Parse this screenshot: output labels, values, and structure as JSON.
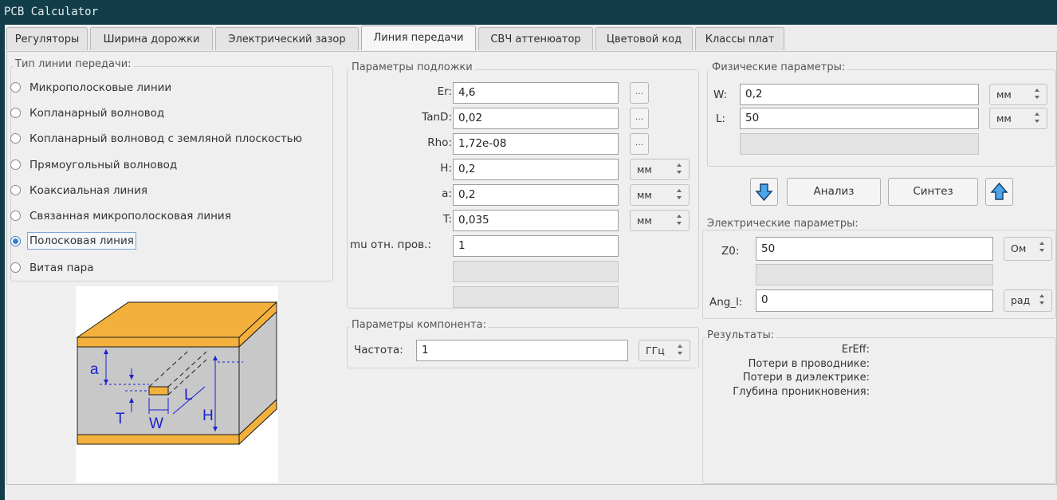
{
  "window": {
    "title": "PCB Calculator"
  },
  "tabs": [
    "Регуляторы",
    "Ширина дорожки",
    "Электрический зазор",
    "Линия передачи",
    "СВЧ аттенюатор",
    "Цветовой код",
    "Классы плат"
  ],
  "line_type": {
    "title": "Тип линии передачи:",
    "options": [
      {
        "label": "Микрополосковые линии",
        "selected": false
      },
      {
        "label": "Копланарный волновод",
        "selected": false
      },
      {
        "label": "Копланарный волновод с земляной плоскостью",
        "selected": false
      },
      {
        "label": "Прямоугольный волновод",
        "selected": false
      },
      {
        "label": "Коаксиальная линия",
        "selected": false
      },
      {
        "label": "Связанная микрополосковая линия",
        "selected": false
      },
      {
        "label": "Полосковая линия",
        "selected": true
      },
      {
        "label": "Витая пара",
        "selected": false
      }
    ]
  },
  "diagram": {
    "labels": {
      "a": "a",
      "T": "T",
      "W": "W",
      "L": "L",
      "H": "H"
    },
    "colors": {
      "copper": "#f4b03c",
      "dielectric": "#c8c8c8",
      "dim": "#1a22d0"
    }
  },
  "substrate": {
    "title": "Параметры подложки",
    "rows": [
      {
        "label": "Er:",
        "value": "4,6",
        "button": "..."
      },
      {
        "label": "TanD:",
        "value": "0,02",
        "button": "..."
      },
      {
        "label": "Rho:",
        "value": "1,72e-08",
        "button": "..."
      },
      {
        "label": "H:",
        "value": "0,2",
        "unit": "мм"
      },
      {
        "label": "a:",
        "value": "0,2",
        "unit": "мм"
      },
      {
        "label": "T:",
        "value": "0,035",
        "unit": "мм"
      },
      {
        "label": "mu отн. пров.:",
        "value": "1"
      }
    ]
  },
  "component": {
    "title": "Параметры компонента:",
    "label": "Частота:",
    "value": "1",
    "unit": "ГГц"
  },
  "physical": {
    "title": "Физические параметры:",
    "W": {
      "label": "W:",
      "value": "0,2",
      "unit": "мм"
    },
    "L": {
      "label": "L:",
      "value": "50",
      "unit": "мм"
    }
  },
  "actions": {
    "analyze": "Анализ",
    "synthesize": "Синтез"
  },
  "electrical": {
    "title": "Электрические параметры:",
    "Z0": {
      "label": "Z0:",
      "value": "50",
      "unit": "Ом"
    },
    "Ang": {
      "label": "Ang_l:",
      "value": "0",
      "unit": "рад"
    }
  },
  "results": {
    "title": "Результаты:",
    "items": [
      "ErEff:",
      "Потери в проводнике:",
      "Потери в диэлектрике:",
      "Глубина проникновения:"
    ]
  }
}
